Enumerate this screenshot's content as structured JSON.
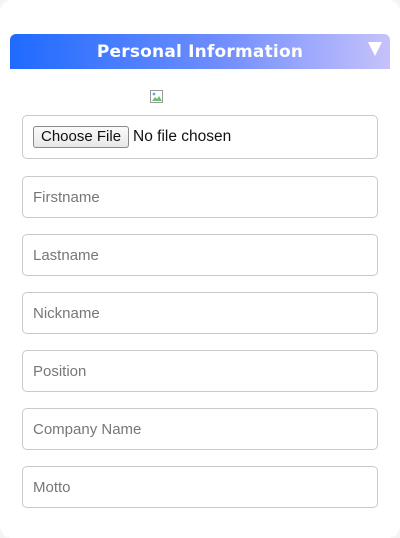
{
  "section": {
    "title": "Personal Information",
    "toggle_icon": "triangle-down-icon"
  },
  "avatar": {
    "icon": "broken-image-icon"
  },
  "file_upload": {
    "button_label": "Choose File",
    "status": "No file chosen"
  },
  "fields": {
    "firstname_placeholder": "Firstname",
    "lastname_placeholder": "Lastname",
    "nickname_placeholder": "Nickname",
    "position_placeholder": "Position",
    "company_placeholder": "Company Name",
    "motto_placeholder": "Motto"
  },
  "colors": {
    "header_gradient_start": "#1f6bff",
    "header_gradient_end": "#c6c2fb",
    "border": "#c9c9cf"
  }
}
